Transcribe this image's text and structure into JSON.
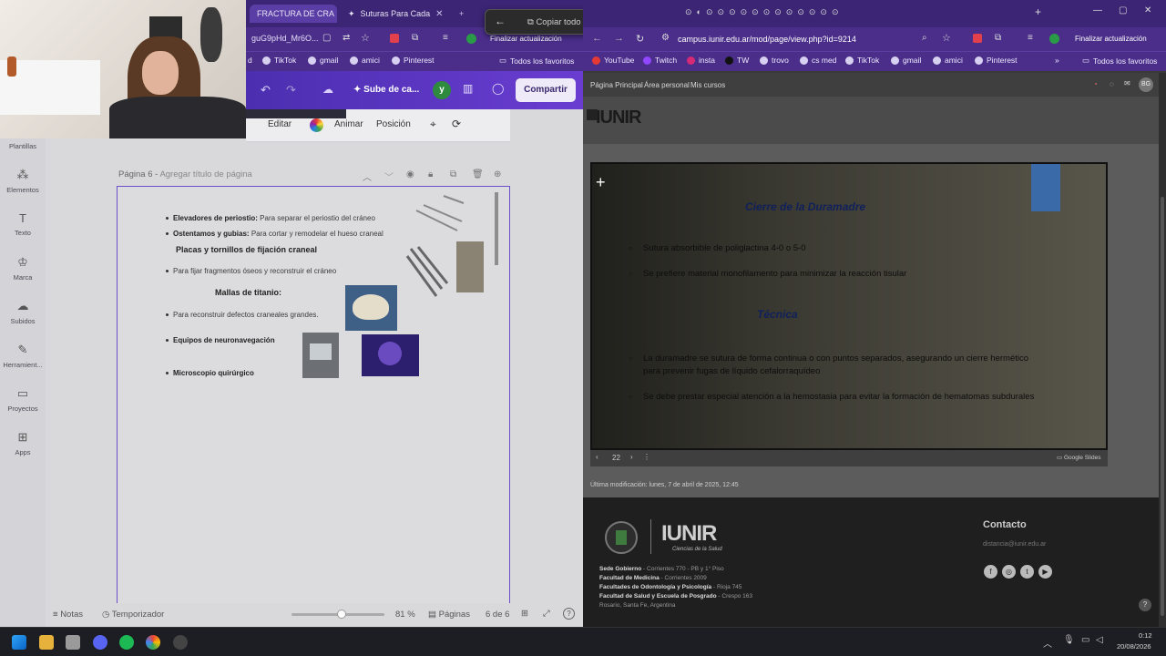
{
  "left_browser": {
    "tabs": [
      {
        "label": "FRACTURA DE CRA"
      },
      {
        "label": "Suturas Para Cada"
      }
    ],
    "address_fragment": "guG9pHd_Mr6O...",
    "update_label": "Finalizar actualización",
    "bookmarks": [
      "TikTok",
      "gmail",
      "amici",
      "Pinterest"
    ],
    "all_bookmarks_label": "Todos los favoritos"
  },
  "canva": {
    "save_label": "Sube de ca...",
    "avatar_letter": "y",
    "share_label": "Compartir",
    "context_menu": {
      "edit": "Editar",
      "animate": "Animar",
      "position": "Posición"
    },
    "sidebar": [
      {
        "label": "Plantillas",
        "icon": "templates-icon"
      },
      {
        "label": "Elementos",
        "icon": "elements-icon"
      },
      {
        "label": "Texto",
        "icon": "text-icon"
      },
      {
        "label": "Marca",
        "icon": "brand-icon"
      },
      {
        "label": "Subidos",
        "icon": "uploads-icon"
      },
      {
        "label": "Herramient...",
        "icon": "tools-icon"
      },
      {
        "label": "Proyectos",
        "icon": "folder-icon"
      },
      {
        "label": "Apps",
        "icon": "apps-icon"
      }
    ],
    "page_title": "Página 6",
    "page_subtitle": "Agregar título de página",
    "slide": {
      "item1_bold": "Elevadores de periostio:",
      "item1_text": "Para separar el periostio del cráneo",
      "item2_bold": "Ostentamos y gubias:",
      "item2_text": "Para cortar y remodelar el hueso craneal",
      "heading1": "Placas y tornillos de fijación craneal",
      "item3_text": "Para fijar fragmentos óseos y reconstruir el cráneo",
      "heading2": "Mallas de titanio:",
      "item4_text": "Para reconstruir defectos craneales grandes.",
      "item5_bold": "Equipos de neuronavegación",
      "item6_bold": "Microscopio quirúrgico"
    },
    "bottom_bar": {
      "notes": "Notas",
      "timer": "Temporizador",
      "zoom": "81 %",
      "pages_label": "Páginas",
      "page_count": "6 de 6"
    }
  },
  "copy_toolbar": {
    "label": "Copiar todo el texto"
  },
  "right_browser": {
    "url": "campus.iunir.edu.ar/mod/page/view.php?id=9214",
    "update_label": "Finalizar actualización",
    "bookmarks": [
      "YouTube",
      "Twitch",
      "insta",
      "TW",
      "trovo",
      "cs med",
      "TikTok",
      "gmail",
      "amici",
      "Pinterest"
    ],
    "all_bookmarks_label": "Todos los favoritos"
  },
  "moodle": {
    "nav": [
      "Página Principal",
      "Área personal",
      "Mis cursos"
    ],
    "user_initials": "BG",
    "logo_text": "IUNIR",
    "slide": {
      "title1": "Cierre de la Duramadre",
      "bullet1": "Sutura absorbible de poliglactina 4-0 o 5-0",
      "bullet2": "Se prefiere material monofilamento para minimizar la reacción tisular",
      "title2": "Técnica",
      "bullet3_line1": "La duramadre se sutura de forma continua o con puntos separados, asegurando un cierre hermético",
      "bullet3_line2": "para prevenir fugas de líquido cefalorraquídeo",
      "bullet4": "Se debe prestar especial atención a la hemostasia para evitar la formación de hematomas subdurales"
    },
    "slide_page": "22",
    "slides_brand": "Google Slides",
    "last_modified": "Última modificación: lunes, 7 de abril de 2025, 12:45",
    "footer": {
      "logo_text": "IUNIR",
      "logo_sub": "Ciencias de la Salud",
      "contact_title": "Contacto",
      "contact_email": "distancia@iunir.edu.ar",
      "addresses": [
        {
          "name": "Sede Gobierno",
          "addr": "Corrientes 770 - PB y 1° Piso"
        },
        {
          "name": "Facultad de Medicina",
          "addr": "Corrientes 2009"
        },
        {
          "name": "Facultades de Odontología y Psicología",
          "addr": "Rioja 745"
        },
        {
          "name": "Facultad de Salud y Escuela de Posgrado",
          "addr": "Crespo 163"
        }
      ],
      "city": "Rosario, Santa Fe, Argentina"
    }
  },
  "taskbar": {
    "time": "0:12",
    "date": "20/08/2026"
  }
}
